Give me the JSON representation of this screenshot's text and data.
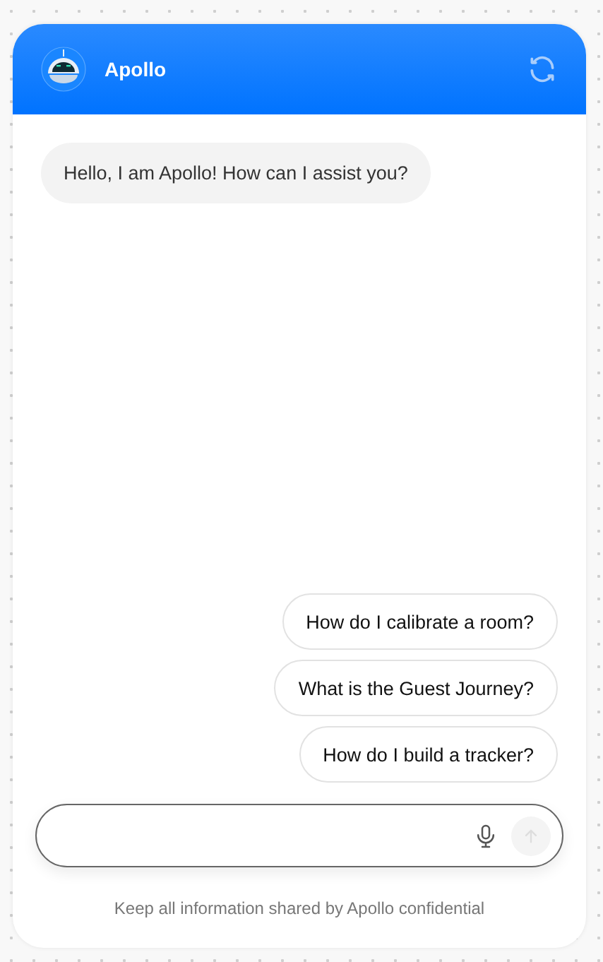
{
  "header": {
    "title": "Apollo"
  },
  "messages": [
    "Hello, I am Apollo! How can I assist you?"
  ],
  "suggestions": [
    "How do I calibrate a room?",
    "What is the Guest Journey?",
    "How do I build a tracker?"
  ],
  "composer": {
    "send_disabled": true
  },
  "footer": "Keep all information shared by Apollo confidential"
}
